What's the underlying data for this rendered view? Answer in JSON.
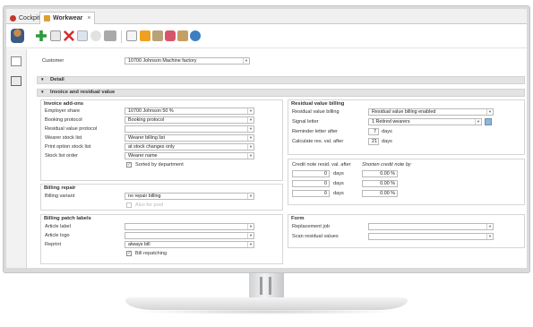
{
  "tabs": [
    {
      "label": "Cockpit",
      "icon": "cockpit-icon"
    },
    {
      "label": "Workwear",
      "icon": "workwear-icon",
      "close": "×"
    }
  ],
  "toolbar": {
    "icons": [
      "users-icon",
      "add-icon",
      "copy-icon",
      "delete-icon",
      "save-icon",
      "undo-icon",
      "print-icon",
      "document-icon",
      "chart-icon",
      "report-icon",
      "eraser-icon",
      "tools-icon",
      "globe-icon"
    ]
  },
  "customer": {
    "label": "Customer",
    "value": "10700    Johnson Machine factory"
  },
  "sections": {
    "detail": "Detail",
    "invoice_residual": "Invoice and residual value"
  },
  "invoice_addons": {
    "title": "Invoice add-ons",
    "rows": [
      {
        "label": "Employer share",
        "value": "10700    Johnson 50 %"
      },
      {
        "label": "Booking protocol",
        "value": "Booking protocol"
      },
      {
        "label": "Residual value protocol",
        "value": ""
      },
      {
        "label": "Wearer stock list",
        "value": "Wearer billing list"
      },
      {
        "label": "Print option stock list",
        "value": "at stock changes only"
      },
      {
        "label": "Stock list order",
        "value": "Wearer name"
      }
    ],
    "sorted_label": "Sorted by department"
  },
  "billing_repair": {
    "title": "Billing repair",
    "variant_label": "Billing variant",
    "variant_value": "no repair billing",
    "also_pool_label": "Also for pool"
  },
  "patch_labels": {
    "title": "Billing patch labels",
    "rows": [
      {
        "label": "Article label",
        "value": ""
      },
      {
        "label": "Article logo",
        "value": ""
      },
      {
        "label": "Reprint",
        "value": "always bill"
      }
    ],
    "repatching_label": "Bill repatching"
  },
  "residual_billing": {
    "title": "Residual value billing",
    "billing_label": "Residual value billing",
    "billing_value": "Residual value billing enabled",
    "signal_label": "Signal letter",
    "signal_value": "1    Retired wearers",
    "reminder_label": "Reminder letter after",
    "reminder_value": "7",
    "reminder_unit": "days",
    "calc_label": "Calculate res. val. after",
    "calc_value": "21",
    "calc_unit": "days"
  },
  "credit_note": {
    "col1_header": "Credit note resid. val. after",
    "col2_header": "Shorten credit note by",
    "rows": [
      {
        "days": "0",
        "unit": "days",
        "percent": "0.00 %"
      },
      {
        "days": "0",
        "unit": "days",
        "percent": "0.00 %"
      },
      {
        "days": "0",
        "unit": "days",
        "percent": "0.00 %"
      }
    ]
  },
  "form": {
    "title": "Form",
    "replacement_label": "Replacement job",
    "replacement_value": "",
    "scan_label": "Scan residual values",
    "scan_value": ""
  },
  "colors": {
    "accent": "#2a6db2",
    "section_bar": "#e3e3e3",
    "border": "#b9b9b9"
  }
}
